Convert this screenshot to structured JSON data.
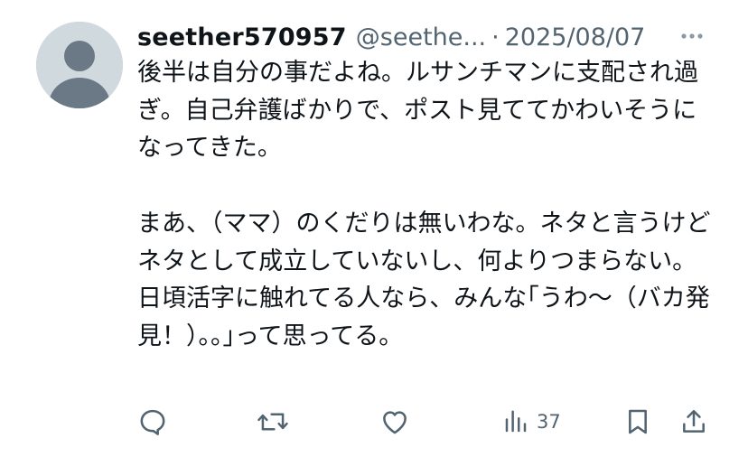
{
  "post": {
    "display_name": "seether570957",
    "handle": "@seethe...",
    "separator": "·",
    "date": "2025/08/07",
    "paragraphs": [
      "後半は自分の事だよね。ルサンチマンに支配され過ぎ。自己弁護ばかりで、ポスト見ててかわいそうになってきた。",
      "",
      "まあ、（ママ）のくだりは無いわな。ネタと言うけどネタとして成立していないし、何よりつまらない。",
      "日頃活字に触れてる人なら、みんな｢うわ～（バカ発見！）。。｣って思ってる。"
    ]
  },
  "actions": {
    "reply_icon": "reply-icon",
    "repost_icon": "repost-icon",
    "like_icon": "heart-icon",
    "views_icon": "views-chart-icon",
    "views_count": "37",
    "bookmark_icon": "bookmark-icon",
    "share_icon": "share-icon"
  },
  "colors": {
    "text": "#0f1419",
    "secondary": "#536471",
    "avatar_bg": "#cfd9de",
    "avatar_fg": "#6b7986"
  }
}
